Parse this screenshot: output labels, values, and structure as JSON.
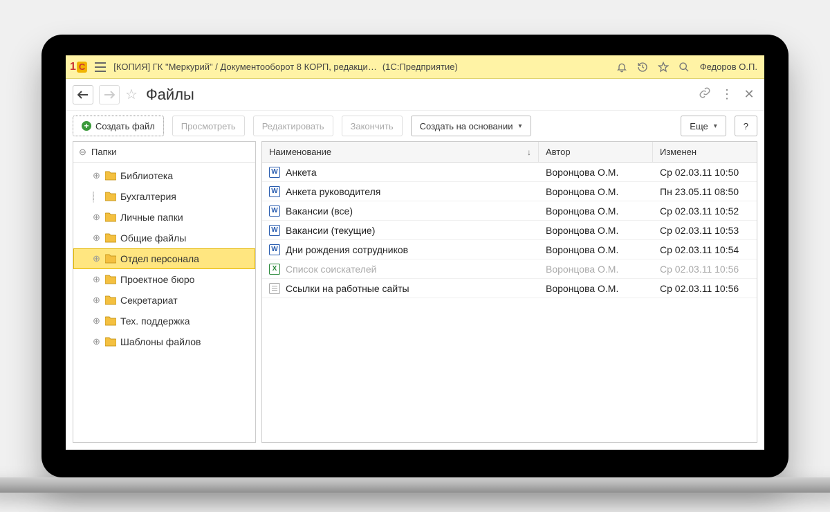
{
  "titlebar": {
    "app_title": "[КОПИЯ] ГК \"Меркурий\" / Документооборот 8 КОРП, редакци…",
    "app_sub": "(1С:Предприятие)",
    "user": "Федоров О.П."
  },
  "page": {
    "title": "Файлы"
  },
  "toolbar": {
    "create_file": "Создать файл",
    "view": "Просмотреть",
    "edit": "Редактировать",
    "finish": "Закончить",
    "create_based": "Создать на основании",
    "more": "Еще",
    "help": "?"
  },
  "tree": {
    "root": "Папки",
    "items": [
      {
        "label": "Библиотека",
        "state": "plus"
      },
      {
        "label": "Бухгалтерия",
        "state": "loading"
      },
      {
        "label": "Личные папки",
        "state": "plus"
      },
      {
        "label": "Общие файлы",
        "state": "plus"
      },
      {
        "label": "Отдел персонала",
        "state": "plus",
        "selected": true
      },
      {
        "label": "Проектное бюро",
        "state": "plus"
      },
      {
        "label": "Секретариат",
        "state": "plus"
      },
      {
        "label": "Тех. поддержка",
        "state": "plus"
      },
      {
        "label": "Шаблоны файлов",
        "state": "plus"
      }
    ]
  },
  "list": {
    "columns": {
      "name": "Наименование",
      "author": "Автор",
      "modified": "Изменен"
    },
    "rows": [
      {
        "icon": "word",
        "name": "Анкета",
        "author": "Воронцова О.М.",
        "modified": "Ср 02.03.11 10:50"
      },
      {
        "icon": "word",
        "name": "Анкета руководителя",
        "author": "Воронцова О.М.",
        "modified": "Пн 23.05.11 08:50"
      },
      {
        "icon": "word",
        "name": "Вакансии (все)",
        "author": "Воронцова О.М.",
        "modified": "Ср 02.03.11 10:52"
      },
      {
        "icon": "word",
        "name": "Вакансии (текущие)",
        "author": "Воронцова О.М.",
        "modified": "Ср 02.03.11 10:53"
      },
      {
        "icon": "word",
        "name": "Дни рождения сотрудников",
        "author": "Воронцова О.М.",
        "modified": "Ср 02.03.11 10:54"
      },
      {
        "icon": "excel",
        "name": "Список соискателей",
        "author": "Воронцова О.М.",
        "modified": "Ср 02.03.11 10:56",
        "dim": true
      },
      {
        "icon": "text",
        "name": "Ссылки на работные сайты",
        "author": "Воронцова О.М.",
        "modified": "Ср 02.03.11 10:56"
      }
    ]
  }
}
